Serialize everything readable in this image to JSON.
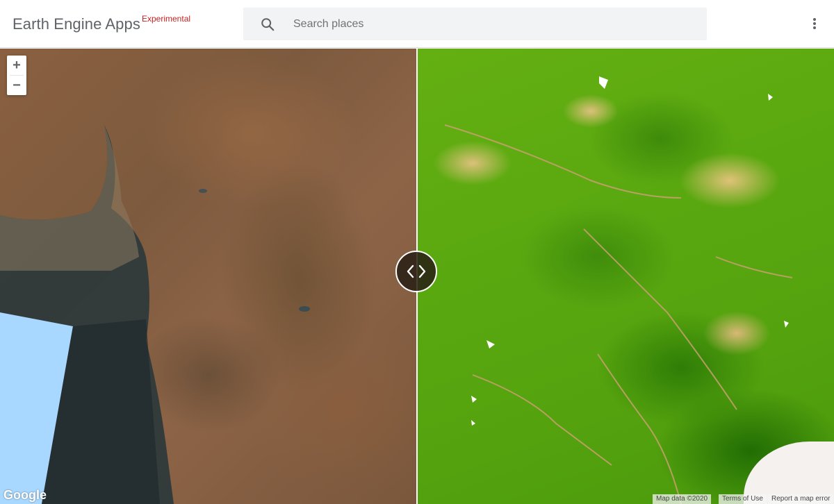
{
  "header": {
    "title": "Earth Engine Apps",
    "badge": "Experimental",
    "search_placeholder": "Search places",
    "search_icon": "search-icon",
    "menu_icon": "more-vert-icon"
  },
  "map": {
    "zoom_in_label": "+",
    "zoom_out_label": "−",
    "compare_handle_icon": "chevron-left-right-icon",
    "google_logo": "Google",
    "attribution": {
      "map_data": "Map data ©2020",
      "terms": "Terms of Use",
      "report": "Report a map error"
    }
  },
  "colors": {
    "badge": "#c5221f",
    "vegetation_high": "#226d04",
    "vegetation_mid": "#5aa810",
    "vegetation_low": "#dcc07a",
    "water": "#a8d8ff"
  }
}
